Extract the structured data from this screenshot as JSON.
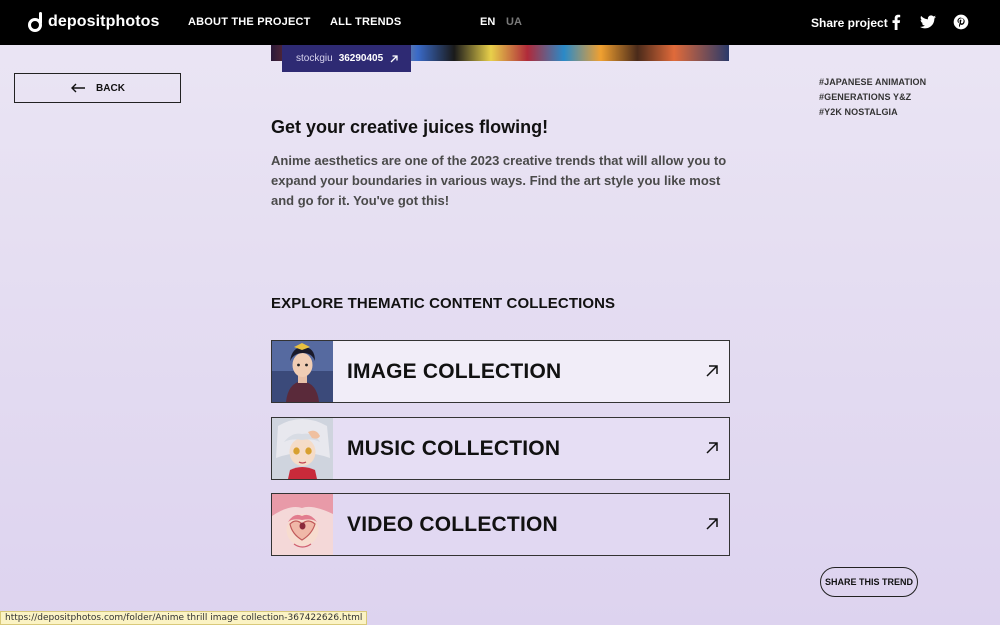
{
  "nav": {
    "logo_text": "depositphotos",
    "about": "ABOUT THE PROJECT",
    "trends": "ALL TRENDS",
    "lang_en": "EN",
    "lang_ua": "UA",
    "share_project": "Share project",
    "social_icons": [
      "facebook-icon",
      "twitter-icon",
      "pinterest-icon"
    ]
  },
  "credit": {
    "author": "stockgiu",
    "id": "36290405"
  },
  "back_label": "BACK",
  "tags": [
    "#JAPANESE ANIMATION",
    "#GENERATIONS Y&Z",
    "#Y2K NOSTALGIA"
  ],
  "heading": "Get your creative juices flowing!",
  "paragraph": "Anime aesthetics are one of the 2023 creative trends that will allow you to expand your boundaries in various ways. Find the art style you like most and go for it. You've got this!",
  "explore_title": "EXPLORE THEMATIC CONTENT COLLECTIONS",
  "collections": [
    {
      "label": "IMAGE COLLECTION"
    },
    {
      "label": "MUSIC COLLECTION"
    },
    {
      "label": "VIDEO COLLECTION"
    }
  ],
  "share_trend": "SHARE THIS TREND",
  "status_url": "https://depositphotos.com/folder/Anime thrill image collection-367422626.html",
  "colors": {
    "nav_bg": "#000000",
    "credit_bg": "#2e2a73",
    "page_bg_top": "#ebe6f4",
    "page_bg_bottom": "#ddd3ef"
  }
}
